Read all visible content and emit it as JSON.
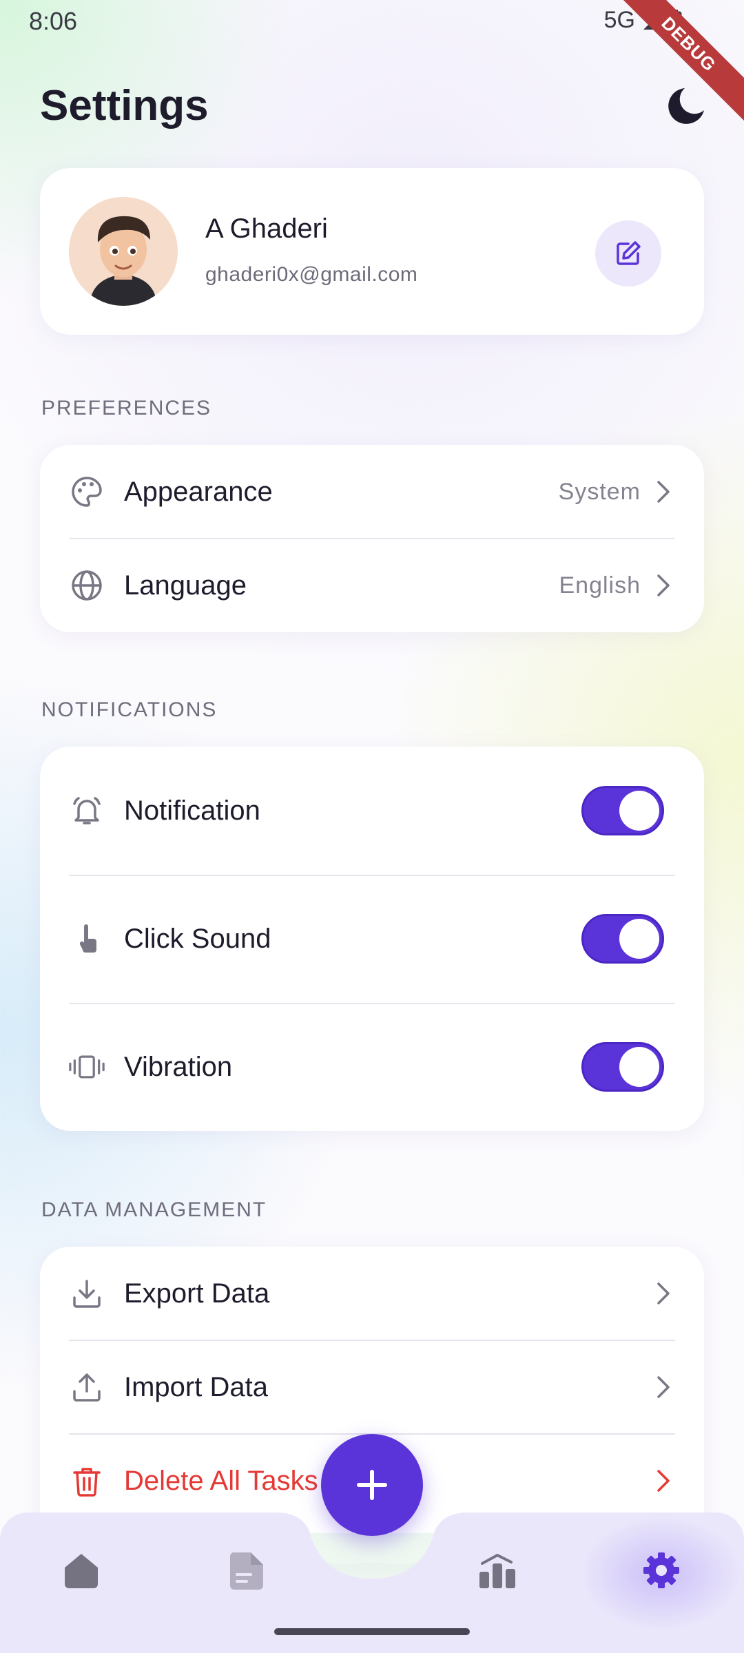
{
  "status_bar": {
    "time": "8:06",
    "network": "5G",
    "debug_label": "DEBUG"
  },
  "header": {
    "title": "Settings",
    "theme_icon": "moon-icon"
  },
  "profile": {
    "name": "A Ghaderi",
    "email": "ghaderi0x@gmail.com",
    "edit_icon": "edit-icon"
  },
  "preferences": {
    "label": "PREFERENCES",
    "items": [
      {
        "label": "Appearance",
        "value": "System",
        "icon": "palette-icon"
      },
      {
        "label": "Language",
        "value": "English",
        "icon": "globe-icon"
      }
    ]
  },
  "notifications": {
    "label": "NOTIFICATIONS",
    "items": [
      {
        "label": "Notification",
        "icon": "bell-icon",
        "enabled": true
      },
      {
        "label": "Click Sound",
        "icon": "tap-icon",
        "enabled": true
      },
      {
        "label": "Vibration",
        "icon": "vibration-icon",
        "enabled": true
      }
    ]
  },
  "data_management": {
    "label": "DATA MANAGEMENT",
    "items": [
      {
        "label": "Export Data",
        "icon": "download-icon"
      },
      {
        "label": "Import Data",
        "icon": "upload-icon"
      },
      {
        "label": "Delete All Tasks",
        "icon": "trash-icon"
      }
    ]
  },
  "bottom_nav": {
    "items": [
      {
        "icon": "home-icon"
      },
      {
        "icon": "document-icon"
      },
      {
        "icon": "chart-icon"
      },
      {
        "icon": "settings-icon",
        "active": true
      }
    ],
    "fab_icon": "plus-icon"
  },
  "colors": {
    "accent": "#5b34d9",
    "danger": "#e53935",
    "nav_background": "#ebe7fb"
  }
}
